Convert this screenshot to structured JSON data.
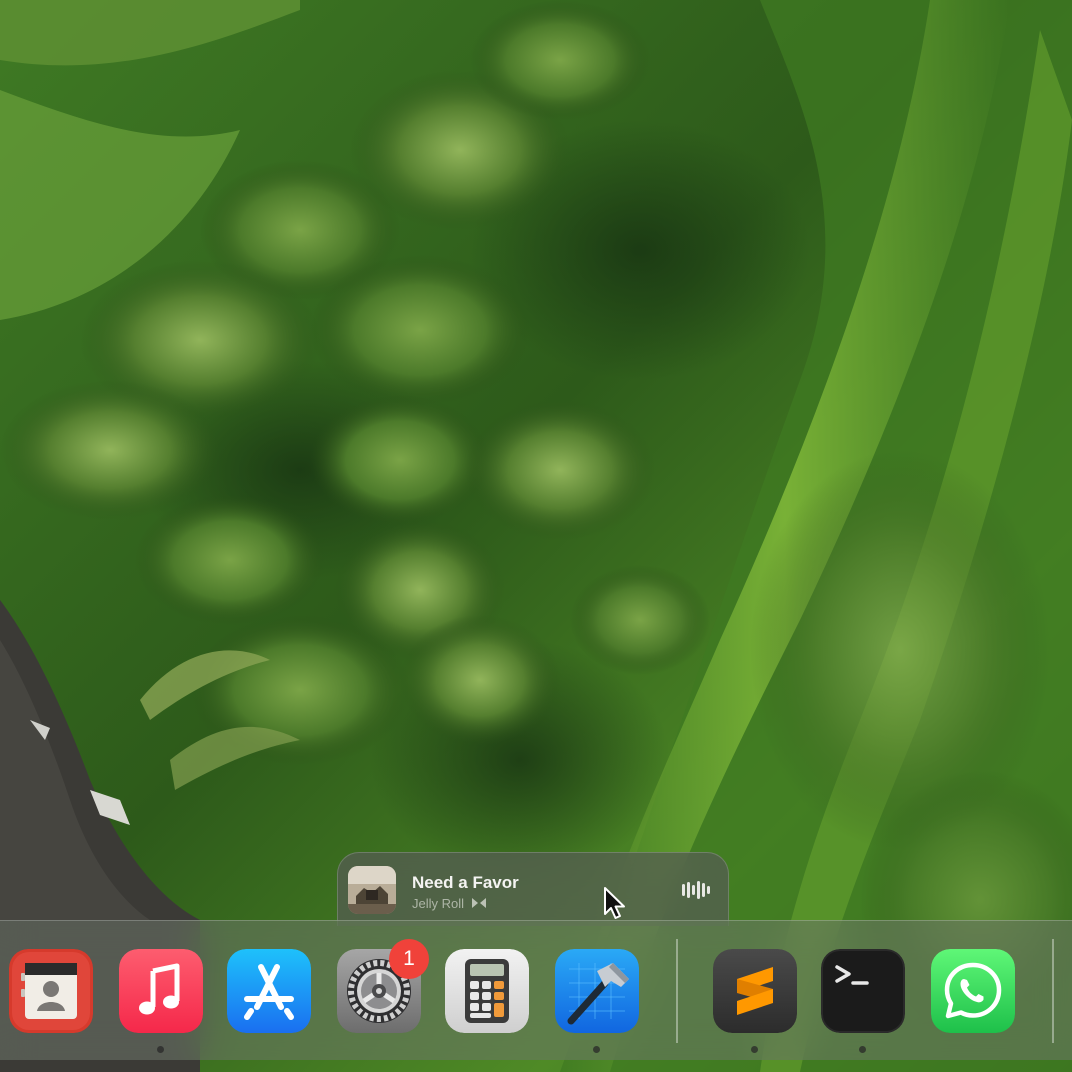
{
  "now_playing": {
    "title": "Need a Favor",
    "artist": "Jelly Roll",
    "album_art_icon": "album-art-image",
    "output_icon": "airplay-icon",
    "visualizer_icon": "waveform-icon"
  },
  "dock": {
    "items": [
      {
        "name": "contacts",
        "icon": "contacts-icon",
        "running": false,
        "badge": ""
      },
      {
        "name": "music",
        "icon": "music-note-icon",
        "running": true,
        "badge": ""
      },
      {
        "name": "app-store",
        "icon": "app-store-icon",
        "running": false,
        "badge": ""
      },
      {
        "name": "system-settings",
        "icon": "gear-icon",
        "running": false,
        "badge": "1"
      },
      {
        "name": "calculator",
        "icon": "calculator-icon",
        "running": false,
        "badge": ""
      },
      {
        "name": "xcode",
        "icon": "hammer-icon",
        "running": true,
        "badge": ""
      },
      {
        "name": "sublime-text",
        "icon": "sublime-s-icon",
        "running": true,
        "badge": ""
      },
      {
        "name": "terminal",
        "icon": "terminal-prompt-icon",
        "running": true,
        "badge": ""
      },
      {
        "name": "whatsapp",
        "icon": "whatsapp-phone-icon",
        "running": false,
        "badge": ""
      }
    ]
  },
  "colors": {
    "wallpaper_green": "#3f6f22",
    "badge_red": "#f0423a",
    "music_red": "#fb3c56",
    "appstore_blue": "#1c8cf4",
    "sublime_orange": "#ff9800",
    "whatsapp_green": "#25d366"
  }
}
